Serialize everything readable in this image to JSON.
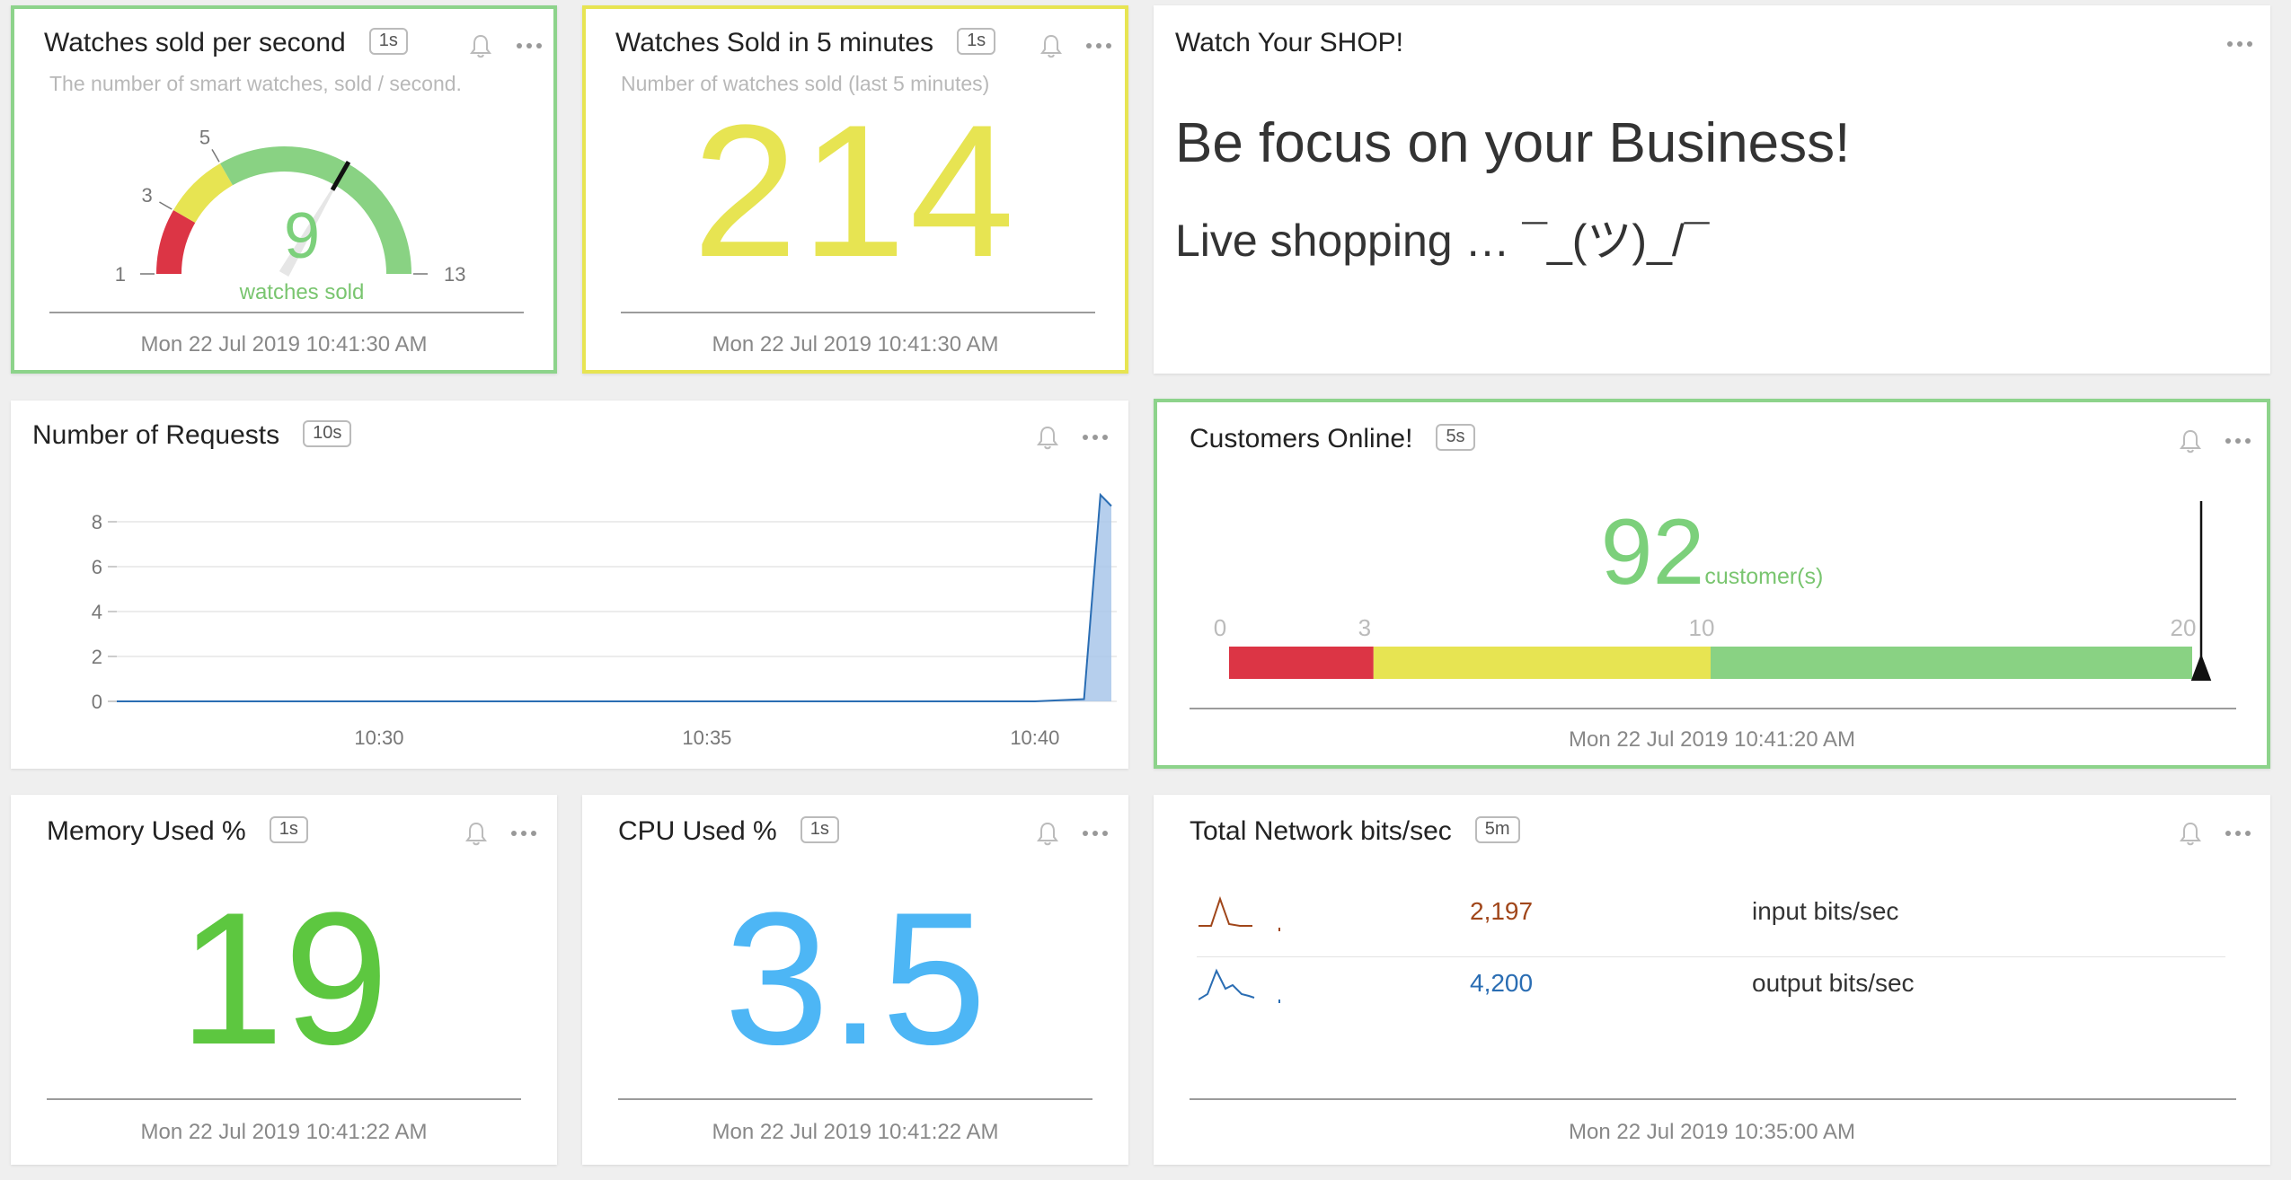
{
  "tiles": {
    "gauge": {
      "title": "Watches sold per second",
      "badge": "1s",
      "subtitle": "The number of smart watches, sold / second.",
      "value": "9",
      "unit": "watches sold",
      "ticks": [
        "1",
        "3",
        "5",
        "13"
      ],
      "gauge_min": 1,
      "gauge_max": 13,
      "gauge_value": 9,
      "bands": [
        {
          "from": 1,
          "to": 3,
          "color": "#dc3545"
        },
        {
          "from": 3,
          "to": 5,
          "color": "#e7e452"
        },
        {
          "from": 5,
          "to": 13,
          "color": "#89d283"
        }
      ],
      "footer": "Mon 22 Jul 2019 10:41:30 AM"
    },
    "sold5": {
      "title": "Watches Sold in 5 minutes",
      "badge": "1s",
      "subtitle": "Number of watches sold (last 5 minutes)",
      "value": "214",
      "footer": "Mon 22 Jul 2019 10:41:30 AM"
    },
    "shop": {
      "title": "Watch Your SHOP!",
      "headline": "Be focus on your Business!",
      "subline": "Live shopping … ¯_(ツ)_/¯"
    },
    "requests": {
      "title": "Number of Requests",
      "badge": "10s",
      "y_ticks": [
        "8",
        "6",
        "4",
        "2",
        "0"
      ],
      "x_ticks": [
        "10:30",
        "10:35",
        "10:40"
      ]
    },
    "customers": {
      "title": "Customers Online!",
      "badge": "5s",
      "value": "92",
      "unit": "customer(s)",
      "scale_labels": [
        "0",
        "3",
        "10",
        "20"
      ],
      "bands": [
        {
          "from": 0,
          "to": 3,
          "color": "#dc3545"
        },
        {
          "from": 3,
          "to": 10,
          "color": "#e7e452"
        },
        {
          "from": 10,
          "to": 20,
          "color": "#89d283"
        }
      ],
      "footer": "Mon 22 Jul 2019 10:41:20 AM"
    },
    "memory": {
      "title": "Memory Used %",
      "badge": "1s",
      "value": "19",
      "footer": "Mon 22 Jul 2019 10:41:22 AM"
    },
    "cpu": {
      "title": "CPU Used %",
      "badge": "1s",
      "value": "3.5",
      "footer": "Mon 22 Jul 2019 10:41:22 AM"
    },
    "network": {
      "title": "Total Network bits/sec",
      "badge": "5m",
      "rows": [
        {
          "value": "2,197",
          "label": "input bits/sec",
          "color": "#a0461a"
        },
        {
          "value": "4,200",
          "label": "output bits/sec",
          "color": "#2a6db3"
        }
      ],
      "footer": "Mon 22 Jul 2019 10:35:00 AM"
    }
  },
  "chart_data": {
    "type": "area",
    "x": [
      "10:26",
      "10:28",
      "10:30",
      "10:32",
      "10:34",
      "10:36",
      "10:38",
      "10:40",
      "10:40:45",
      "10:41",
      "10:41:10"
    ],
    "series": [
      {
        "values": [
          0,
          0,
          0,
          0,
          0,
          0,
          0,
          0,
          0.1,
          9.2,
          8.7
        ]
      }
    ],
    "ylim": [
      0,
      9
    ],
    "x_ticks": [
      "10:30",
      "10:35",
      "10:40"
    ],
    "y_ticks": [
      0,
      2,
      4,
      6,
      8
    ],
    "grid": true
  }
}
